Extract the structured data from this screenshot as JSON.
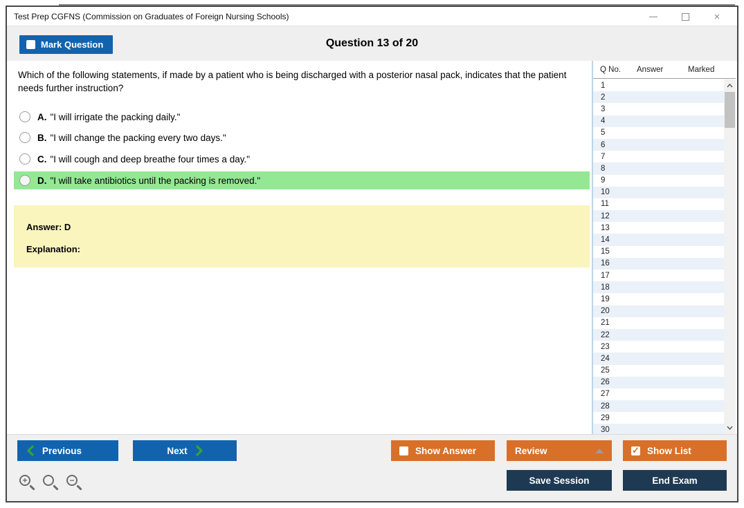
{
  "window": {
    "title": "Test Prep CGFNS (Commission on Graduates of Foreign Nursing Schools)",
    "close_glyph": "×"
  },
  "header": {
    "mark_question": "Mark Question",
    "question_counter": "Question 13 of 20"
  },
  "question": {
    "text": "Which of the following statements, if made by a patient who is being discharged with a posterior nasal pack, indicates that the patient needs further instruction?",
    "options": [
      {
        "letter": "A.",
        "text": "\"I will irrigate the packing daily.\"",
        "highlighted": false
      },
      {
        "letter": "B.",
        "text": "\"I will change the packing every two days.\"",
        "highlighted": false
      },
      {
        "letter": "C.",
        "text": "\"I will cough and deep breathe four times a day.\"",
        "highlighted": false
      },
      {
        "letter": "D.",
        "text": "\"I will take antibiotics until the packing is removed.\"",
        "highlighted": true
      }
    ]
  },
  "answer_panel": {
    "answer": "Answer: D",
    "explanation": "Explanation:"
  },
  "sidebar": {
    "columns": [
      "Q No.",
      "Answer",
      "Marked"
    ],
    "rows": [
      "1",
      "2",
      "3",
      "4",
      "5",
      "6",
      "7",
      "8",
      "9",
      "10",
      "11",
      "12",
      "13",
      "14",
      "15",
      "16",
      "17",
      "18",
      "19",
      "20",
      "21",
      "22",
      "23",
      "24",
      "25",
      "26",
      "27",
      "28",
      "29",
      "30"
    ]
  },
  "footer": {
    "previous": "Previous",
    "next": "Next",
    "show_answer": "Show Answer",
    "review": "Review",
    "show_list": "Show List",
    "save_session": "Save Session",
    "end_exam": "End Exam"
  },
  "colors": {
    "blue": "#1263AE",
    "orange": "#D8702A",
    "navy": "#1E3A52",
    "chevron_green": "#33A532",
    "highlight_green": "#94E894",
    "panel_yellow": "#FAF4BD",
    "alt_row_blue": "#EBF1F8"
  }
}
